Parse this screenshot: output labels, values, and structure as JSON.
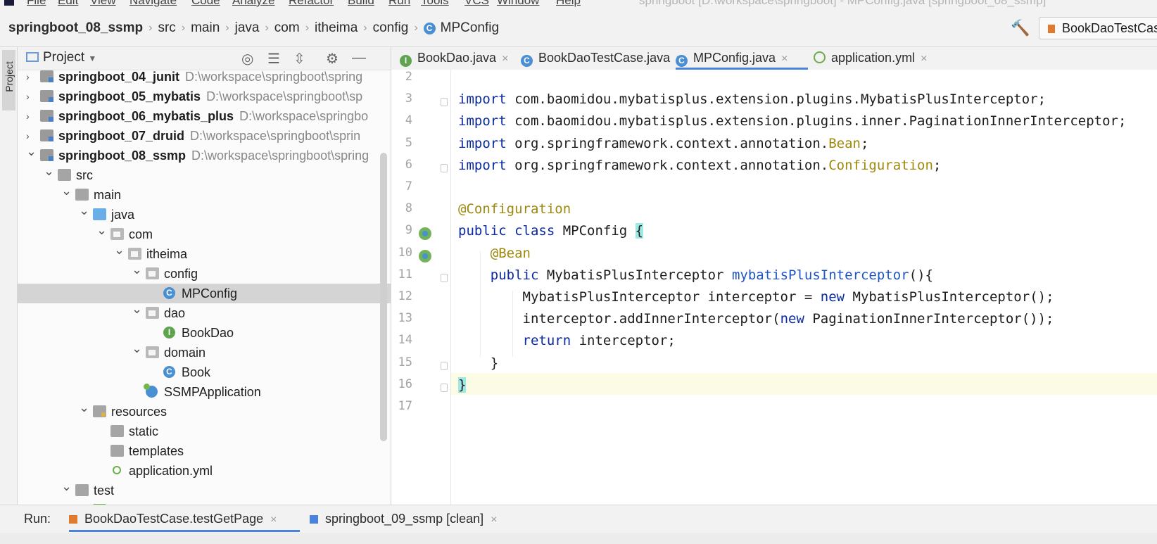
{
  "menu": {
    "items": [
      "File",
      "Edit",
      "View",
      "Navigate",
      "Code",
      "Analyze",
      "Refactor",
      "Build",
      "Run",
      "Tools",
      "VCS",
      "Window",
      "Help"
    ],
    "window_title": "springboot [D:\\workspace\\springboot] - MPConfig.java [springboot_08_ssmp]"
  },
  "breadcrumb": [
    "springboot_08_ssmp",
    "src",
    "main",
    "java",
    "com",
    "itheima",
    "config",
    "MPConfig"
  ],
  "run_config": "BookDaoTestCase",
  "tool_strip": {
    "project_label": "Project"
  },
  "project_panel": {
    "title": "Project",
    "tree": [
      {
        "label": "springboot_04_junit",
        "path": "D:\\workspace\\springboot\\spring",
        "depth": 0,
        "expanded": false,
        "bold": true,
        "icon": "module"
      },
      {
        "label": "springboot_05_mybatis",
        "path": "D:\\workspace\\springboot\\sp",
        "depth": 0,
        "expanded": false,
        "bold": true,
        "icon": "module"
      },
      {
        "label": "springboot_06_mybatis_plus",
        "path": "D:\\workspace\\springbo",
        "depth": 0,
        "expanded": false,
        "bold": true,
        "icon": "module"
      },
      {
        "label": "springboot_07_druid",
        "path": "D:\\workspace\\springboot\\sprin",
        "depth": 0,
        "expanded": false,
        "bold": true,
        "icon": "module"
      },
      {
        "label": "springboot_08_ssmp",
        "path": "D:\\workspace\\springboot\\spring",
        "depth": 0,
        "expanded": true,
        "bold": true,
        "icon": "module"
      },
      {
        "label": "src",
        "depth": 1,
        "expanded": true,
        "icon": "folder"
      },
      {
        "label": "main",
        "depth": 2,
        "expanded": true,
        "icon": "folder"
      },
      {
        "label": "java",
        "depth": 3,
        "expanded": true,
        "icon": "folder-blue"
      },
      {
        "label": "com",
        "depth": 4,
        "expanded": true,
        "icon": "package"
      },
      {
        "label": "itheima",
        "depth": 5,
        "expanded": true,
        "icon": "package"
      },
      {
        "label": "config",
        "depth": 6,
        "expanded": true,
        "icon": "package"
      },
      {
        "label": "MPConfig",
        "depth": 7,
        "icon": "class",
        "selected": true
      },
      {
        "label": "dao",
        "depth": 6,
        "expanded": true,
        "icon": "package"
      },
      {
        "label": "BookDao",
        "depth": 7,
        "icon": "interface"
      },
      {
        "label": "domain",
        "depth": 6,
        "expanded": true,
        "icon": "package"
      },
      {
        "label": "Book",
        "depth": 7,
        "icon": "class"
      },
      {
        "label": "SSMPApplication",
        "depth": 6,
        "icon": "app"
      },
      {
        "label": "resources",
        "depth": 3,
        "expanded": true,
        "icon": "resources"
      },
      {
        "label": "static",
        "depth": 4,
        "icon": "folder"
      },
      {
        "label": "templates",
        "depth": 4,
        "icon": "folder"
      },
      {
        "label": "application.yml",
        "depth": 4,
        "icon": "yml"
      },
      {
        "label": "test",
        "depth": 2,
        "expanded": true,
        "icon": "folder"
      },
      {
        "label": "java",
        "depth": 3,
        "expanded": true,
        "icon": "folder-green"
      }
    ]
  },
  "editor_tabs": [
    {
      "label": "BookDao.java",
      "icon": "I",
      "color": "#5fa550",
      "active": false
    },
    {
      "label": "BookDaoTestCase.java",
      "icon": "C",
      "color": "#4a8fd4",
      "active": false
    },
    {
      "label": "MPConfig.java",
      "icon": "C",
      "color": "#4a8fd4",
      "active": true
    },
    {
      "label": "application.yml",
      "icon": "",
      "color": "#6cae4a",
      "active": false
    }
  ],
  "code": {
    "line_numbers": [
      "2",
      "3",
      "4",
      "5",
      "6",
      "7",
      "8",
      "9",
      "10",
      "11",
      "12",
      "13",
      "14",
      "15",
      "16",
      "17"
    ],
    "lines": [
      {
        "n": "2",
        "segs": []
      },
      {
        "n": "3",
        "segs": [
          {
            "t": "import ",
            "c": "kw"
          },
          {
            "t": "com.baomidou.mybatisplus.extension.plugins.MybatisPlusInterceptor;",
            "c": ""
          }
        ]
      },
      {
        "n": "4",
        "segs": [
          {
            "t": "import ",
            "c": "kw"
          },
          {
            "t": "com.baomidou.mybatisplus.extension.plugins.inner.PaginationInnerInterceptor;",
            "c": ""
          }
        ]
      },
      {
        "n": "5",
        "segs": [
          {
            "t": "import ",
            "c": "kw"
          },
          {
            "t": "org.springframework.context.annotation.",
            "c": ""
          },
          {
            "t": "Bean",
            "c": "ann"
          },
          {
            "t": ";",
            "c": ""
          }
        ]
      },
      {
        "n": "6",
        "segs": [
          {
            "t": "import ",
            "c": "kw"
          },
          {
            "t": "org.springframework.context.annotation.",
            "c": ""
          },
          {
            "t": "Configuration",
            "c": "ann"
          },
          {
            "t": ";",
            "c": ""
          }
        ]
      },
      {
        "n": "7",
        "segs": []
      },
      {
        "n": "8",
        "segs": [
          {
            "t": "@Configuration",
            "c": "ann"
          }
        ]
      },
      {
        "n": "9",
        "segs": [
          {
            "t": "public class ",
            "c": "kw"
          },
          {
            "t": "MPConfig ",
            "c": ""
          },
          {
            "t": "{",
            "c": "brace"
          }
        ]
      },
      {
        "n": "10",
        "segs": [
          {
            "t": "    ",
            "c": ""
          },
          {
            "t": "@Bean",
            "c": "ann"
          }
        ]
      },
      {
        "n": "11",
        "segs": [
          {
            "t": "    ",
            "c": ""
          },
          {
            "t": "public ",
            "c": "kw"
          },
          {
            "t": "MybatisPlusInterceptor ",
            "c": ""
          },
          {
            "t": "mybatisPlusInterceptor",
            "c": "fn"
          },
          {
            "t": "(){",
            "c": ""
          }
        ]
      },
      {
        "n": "12",
        "segs": [
          {
            "t": "        MybatisPlusInterceptor interceptor = ",
            "c": ""
          },
          {
            "t": "new ",
            "c": "kw"
          },
          {
            "t": "MybatisPlusInterceptor();",
            "c": ""
          }
        ]
      },
      {
        "n": "13",
        "segs": [
          {
            "t": "        interceptor.addInnerInterceptor(",
            "c": ""
          },
          {
            "t": "new ",
            "c": "kw"
          },
          {
            "t": "PaginationInnerInterceptor());",
            "c": ""
          }
        ]
      },
      {
        "n": "14",
        "segs": [
          {
            "t": "        ",
            "c": ""
          },
          {
            "t": "return ",
            "c": "kw"
          },
          {
            "t": "interceptor;",
            "c": ""
          }
        ]
      },
      {
        "n": "15",
        "segs": [
          {
            "t": "    }",
            "c": ""
          }
        ]
      },
      {
        "n": "16",
        "segs": [
          {
            "t": "}",
            "c": "caretbox"
          }
        ]
      },
      {
        "n": "17",
        "segs": []
      }
    ]
  },
  "run_panel": {
    "label": "Run:",
    "tabs": [
      {
        "label": "BookDaoTestCase.testGetPage",
        "active": true,
        "color": "#e07a2e"
      },
      {
        "label": "springboot_09_ssmp [clean]",
        "active": false,
        "color": "#4a83d9"
      }
    ]
  },
  "colors": {
    "accent": "#4a83d9",
    "keyword": "#0a2aa0",
    "annotation": "#9e880d",
    "method": "#1e55c4"
  }
}
